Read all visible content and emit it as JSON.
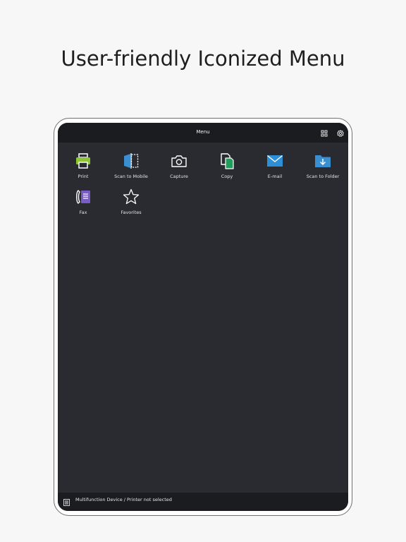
{
  "headline": "User-friendly Iconized Menu",
  "app": {
    "title": "Menu",
    "toolbar_icons": [
      "grid-icon",
      "gear-icon"
    ]
  },
  "menu": {
    "items": [
      {
        "label": "Print",
        "icon": "printer-icon"
      },
      {
        "label": "Scan to Mobile",
        "icon": "scan-to-mobile-icon"
      },
      {
        "label": "Capture",
        "icon": "camera-icon"
      },
      {
        "label": "Copy",
        "icon": "copy-icon"
      },
      {
        "label": "E-mail",
        "icon": "mail-icon"
      },
      {
        "label": "Scan to Folder",
        "icon": "folder-icon"
      },
      {
        "label": "Fax",
        "icon": "fax-icon"
      },
      {
        "label": "Favorites",
        "icon": "star-icon"
      }
    ]
  },
  "status": {
    "text": "Multifunction Device / Printer not selected",
    "icon": "device-icon"
  },
  "colors": {
    "screen_bg": "#2a2b30",
    "bar_bg": "#1b1c1f",
    "print_green": "#8fc43a",
    "scan_blue": "#3a8fd0",
    "copy_green": "#1f9e5a",
    "mail_blue": "#2e8fd6",
    "fax_purple": "#7a5cc8"
  }
}
